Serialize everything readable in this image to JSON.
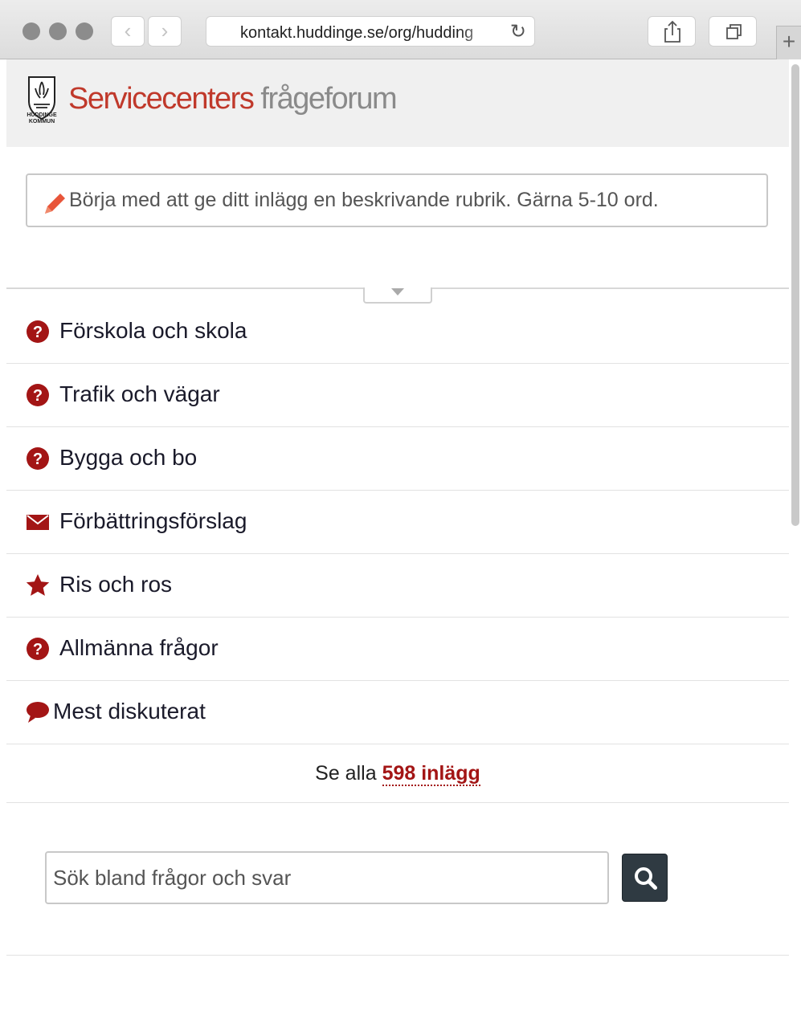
{
  "browser": {
    "url": "kontakt.huddinge.se/org/hudding"
  },
  "header": {
    "logo_text": "HUDDINGE KOMMUN",
    "title_main": "Servicecenters",
    "title_sub": "frågeforum"
  },
  "post": {
    "placeholder": "Börja med att ge ditt inlägg en beskrivande rubrik. Gärna 5-10 ord."
  },
  "categories": [
    {
      "label": "Förskola och skola",
      "icon": "question-circle-icon"
    },
    {
      "label": "Trafik och vägar",
      "icon": "question-circle-icon"
    },
    {
      "label": "Bygga och bo",
      "icon": "question-circle-icon"
    },
    {
      "label": "Förbättringsförslag",
      "icon": "envelope-icon"
    },
    {
      "label": "Ris och ros",
      "icon": "star-icon"
    },
    {
      "label": "Allmänna frågor",
      "icon": "question-circle-icon"
    },
    {
      "label": "Mest diskuterat",
      "icon": "speech-bubble-icon"
    }
  ],
  "see_all": {
    "prefix": "Se alla",
    "link": "598 inlägg"
  },
  "search": {
    "placeholder": "Sök bland frågor och svar"
  },
  "colors": {
    "accent": "#a31515",
    "title_red": "#c0392b",
    "search_button": "#2f3a42"
  }
}
